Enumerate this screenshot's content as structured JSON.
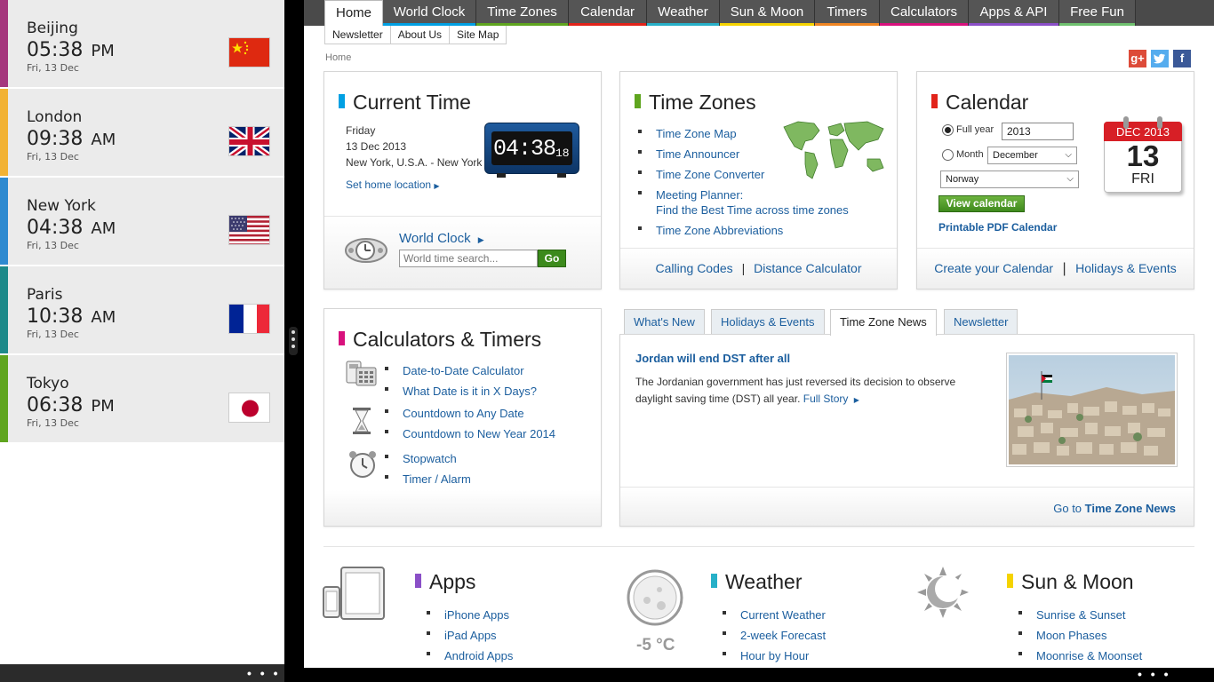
{
  "left_panel": {
    "cities": [
      {
        "name": "Beijing",
        "time": "05:38",
        "ampm": "PM",
        "date": "Fri, 13 Dec",
        "color": "#a5367d"
      },
      {
        "name": "London",
        "time": "09:38",
        "ampm": "AM",
        "date": "Fri, 13 Dec",
        "color": "#f2b233"
      },
      {
        "name": "New York",
        "time": "04:38",
        "ampm": "AM",
        "date": "Fri, 13 Dec",
        "color": "#2e8ad0"
      },
      {
        "name": "Paris",
        "time": "10:38",
        "ampm": "AM",
        "date": "Fri, 13 Dec",
        "color": "#1d8a8a"
      },
      {
        "name": "Tokyo",
        "time": "06:38",
        "ampm": "PM",
        "date": "Fri, 13 Dec",
        "color": "#5fa51f"
      }
    ],
    "more": "• • •"
  },
  "nav": {
    "items": [
      {
        "label": "Home",
        "color": "#ffffff"
      },
      {
        "label": "World Clock",
        "color": "#00a0e3"
      },
      {
        "label": "Time Zones",
        "color": "#5fa51f"
      },
      {
        "label": "Calendar",
        "color": "#e2231a"
      },
      {
        "label": "Weather",
        "color": "#27b0c8"
      },
      {
        "label": "Sun & Moon",
        "color": "#f5d300"
      },
      {
        "label": "Timers",
        "color": "#f08522"
      },
      {
        "label": "Calculators",
        "color": "#d8117d"
      },
      {
        "label": "Apps & API",
        "color": "#8a4fc7"
      },
      {
        "label": "Free Fun",
        "color": "#6fc06f"
      }
    ],
    "sub": [
      "Newsletter",
      "About Us",
      "Site Map"
    ]
  },
  "breadcrumb": "Home",
  "social": {
    "gplus": "g+",
    "twitter": "t",
    "facebook": "f"
  },
  "current_time": {
    "title": "Current Time",
    "day": "Friday",
    "date": "13 Dec 2013",
    "location": "New York, U.S.A. - New York",
    "clock": "04:38",
    "seconds": "18",
    "home_link": "Set home location",
    "world_clock": "World Clock",
    "search_placeholder": "World time search...",
    "go": "Go"
  },
  "time_zones": {
    "title": "Time Zones",
    "links": [
      "Time Zone Map",
      "Time Announcer",
      "Time Zone Converter",
      "Meeting Planner:",
      "Time Zone Abbreviations"
    ],
    "meeting_sub": "Find the Best Time across time zones",
    "footer_a": "Calling Codes",
    "sep": "|",
    "footer_b": "Distance Calculator"
  },
  "calendar": {
    "title": "Calendar",
    "full_year": "Full year",
    "year": "2013",
    "month": "Month",
    "month_value": "December",
    "country": "Norway",
    "view": "View calendar",
    "pdf": "Printable PDF Calendar",
    "icon_month": "DEC",
    "icon_year": "2013",
    "icon_day": "13",
    "icon_dow": "FRI",
    "footer_a": "Create your Calendar",
    "sep": "|",
    "footer_b": "Holidays & Events"
  },
  "calculators": {
    "title": "Calculators & Timers",
    "groups": [
      [
        "Date-to-Date Calculator",
        "What Date is it in X Days?"
      ],
      [
        "Countdown to Any Date",
        "Countdown to New Year 2014"
      ],
      [
        "Stopwatch",
        "Timer / Alarm"
      ]
    ]
  },
  "news": {
    "tabs": [
      "What's New",
      "Holidays & Events",
      "Time Zone News",
      "Newsletter"
    ],
    "headline": "Jordan will end DST after all",
    "body": "The Jordanian government has just reversed its decision to observe daylight saving time (DST) all year.",
    "full_story": "Full Story",
    "goto_prefix": "Go to",
    "goto_strong": "Time Zone News"
  },
  "bottom": {
    "apps": {
      "title": "Apps",
      "links": [
        "iPhone Apps",
        "iPad Apps",
        "Android Apps"
      ]
    },
    "weather": {
      "title": "Weather",
      "temp": "-5 °C",
      "links": [
        "Current Weather",
        "2-week Forecast",
        "Hour by Hour"
      ]
    },
    "sun_moon": {
      "title": "Sun & Moon",
      "links": [
        "Sunrise & Sunset",
        "Moon Phases",
        "Moonrise & Moonset"
      ]
    }
  },
  "colors": {
    "link": "#1b5e9e",
    "cyan": "#00a0e3",
    "green": "#5fa51f",
    "red": "#e2231a",
    "magenta": "#d8117d",
    "purple": "#8a4fc7",
    "teal": "#27b0c8",
    "yellow": "#f5d300"
  }
}
